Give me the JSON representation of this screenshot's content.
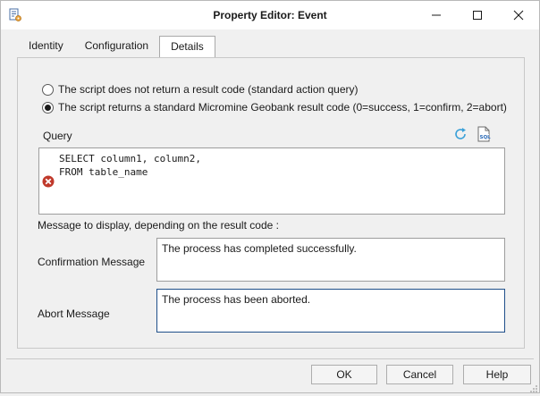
{
  "window": {
    "title": "Property Editor:  Event",
    "app_icon": "script-gear-icon"
  },
  "controls": {
    "minimize": "minimize-icon",
    "maximize": "maximize-icon",
    "close": "close-icon"
  },
  "tabs": [
    {
      "label": "Identity",
      "active": false
    },
    {
      "label": "Configuration",
      "active": false
    },
    {
      "label": "Details",
      "active": true
    }
  ],
  "details": {
    "radio_options": [
      {
        "label": "The script does not return a result code (standard action query)",
        "checked": false
      },
      {
        "label": "The script returns a standard Micromine Geobank result code (0=success, 1=confirm, 2=abort)",
        "checked": true
      }
    ],
    "query_label": "Query",
    "query_icons": [
      "refresh-icon",
      "sql-file-icon"
    ],
    "query_text": "SELECT column1, column2,\nFROM table_name",
    "query_status_icon": "error-icon",
    "message_section_label": "Message to display, depending on the result code :",
    "confirmation_label": "Confirmation Message",
    "confirmation_value": "The process has completed successfully.",
    "abort_label": "Abort Message",
    "abort_value": "The process has been aborted."
  },
  "footer": {
    "ok_label": "OK",
    "cancel_label": "Cancel",
    "help_label": "Help"
  },
  "colors": {
    "accent": "#1f4f8a",
    "error": "#c0392b",
    "refresh": "#3aa0d8"
  }
}
